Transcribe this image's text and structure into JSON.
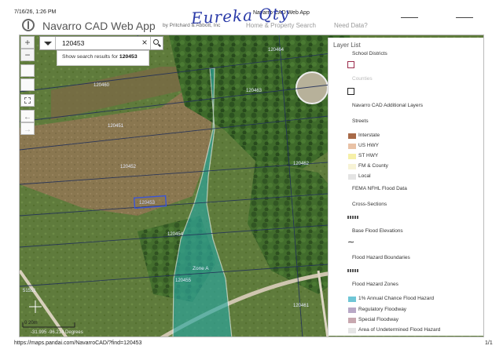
{
  "print_header": {
    "date": "7/16/26, 1:26 PM",
    "title": "Navarro CAD Web App"
  },
  "handwriting": "Eureka Qty",
  "app": {
    "name": "Navarro CAD Web App",
    "byline": "by Pritchard & Abbott, Inc",
    "nav": [
      "Home & Property Search",
      "Need Data?"
    ]
  },
  "search": {
    "value": "120453",
    "results_prefix": "Show search results for",
    "results_term": "120453"
  },
  "map_tools": {
    "zoom_in": "+",
    "zoom_out": "−"
  },
  "map_labels": {
    "parcels": [
      "120460",
      "120451",
      "120452",
      "120453",
      "120454",
      "120455",
      "120456",
      "120464",
      "120463",
      "120462",
      "120461",
      "51551"
    ],
    "zone": "Zone A",
    "scale": "0    20m",
    "coordinates": "-31.995 -96.214 Degrees"
  },
  "layer_list": {
    "title": "Layer List",
    "items": [
      {
        "label": "School Districts",
        "type": "group"
      },
      {
        "label": "",
        "type": "outline",
        "color": "#9b2a4a"
      },
      {
        "label": "Counties",
        "type": "faded"
      },
      {
        "label": "",
        "type": "outline",
        "color": "#222222"
      },
      {
        "label": "Navarro CAD Additional Layers",
        "type": "group"
      },
      {
        "label": "Streets",
        "type": "group"
      },
      {
        "label": "Interstate",
        "type": "swatch",
        "color": "#a86a48"
      },
      {
        "label": "US HWY",
        "type": "swatch",
        "color": "#e9c2a6"
      },
      {
        "label": "ST HWY",
        "type": "swatch",
        "color": "#f6f0a8"
      },
      {
        "label": "FM & County",
        "type": "swatch",
        "color": "#f7f3d6"
      },
      {
        "label": "Local",
        "type": "swatch",
        "color": "#e4e4e4"
      },
      {
        "label": "FEMA NFHL Flood Data",
        "type": "group"
      },
      {
        "label": "Cross-Sections",
        "type": "group"
      },
      {
        "label": "",
        "type": "pattern"
      },
      {
        "label": "Base Flood Elevations",
        "type": "group"
      },
      {
        "label": "",
        "type": "wave"
      },
      {
        "label": "Flood Hazard Boundaries",
        "type": "group"
      },
      {
        "label": "",
        "type": "pattern"
      },
      {
        "label": "Flood Hazard Zones",
        "type": "group"
      },
      {
        "label": "1% Annual Chance Flood Hazard",
        "type": "swatch",
        "color": "#6fc6d6"
      },
      {
        "label": "Regulatory Floodway",
        "type": "swatch",
        "color": "#b8a8c6"
      },
      {
        "label": "Special Floodway",
        "type": "swatch",
        "color": "#c8a8b0"
      },
      {
        "label": "Area of Undetermined Flood Hazard",
        "type": "swatch",
        "color": "#e6e6e6"
      }
    ]
  },
  "print_footer": {
    "url": "https://maps.pandai.com/NavarroCAD/?find=120453",
    "page": "1/1"
  },
  "colors": {
    "flood_zone": "#2aa6a0",
    "selected_parcel": "#3b55d6",
    "field": "#86734e",
    "pasture": "#5b7a3a",
    "trees": "#2f5a22"
  }
}
